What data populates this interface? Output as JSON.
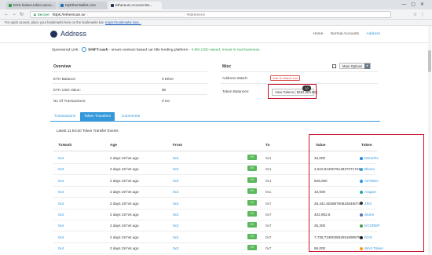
{
  "browser": {
    "tabs": [
      {
        "title": "EOS.halves.token.amou...",
        "favicon_color": "#2d9c4a"
      },
      {
        "title": "MyEtherWallet.com",
        "favicon_color": "#1f6fb5"
      },
      {
        "title": "Ethereum Account Bo...",
        "favicon_color": "#21325b"
      }
    ],
    "url_secure_label": "Secure",
    "url_prefix": "https://etherscan.io/",
    "url_suffix": "#tokentxns",
    "bookmarks_text": "For quick access, place your bookmarks here on the bookmarks bar.",
    "bookmarks_link": "Import bookmarks now..."
  },
  "site": {
    "title": "Address",
    "nav": [
      "Home",
      "Normal Accounts",
      "Address"
    ]
  },
  "sponsored": {
    "label": "Sponsored Link:",
    "name": "SHIFT.cash",
    "desc": "- smart-contract based car title lending platform -",
    "highlight": "4.9M USD raised. Invest in real business."
  },
  "overview": {
    "title": "Overview",
    "rows": [
      {
        "label": "ETH Balance:",
        "value": "0 Ether"
      },
      {
        "label": "ETH USD Value:",
        "value": "$0"
      },
      {
        "label": "No Of Transactions:",
        "value": "0 txn"
      }
    ]
  },
  "misc": {
    "title": "Misc",
    "more_options": "More Options",
    "address_watch_label": "Address Watch:",
    "watch_button": "Add To Watch List",
    "token_balances_label": "Token Balances:",
    "view_tokens": "View Tokens ( $352,859.93 )",
    "token_count": "10"
  },
  "tabs": [
    "Transactions",
    "Token Transfers",
    "Comments"
  ],
  "active_tab": "Token Transfers",
  "events_caption": "Latest 11 Erc20 Token Transfer Events",
  "table": {
    "headers": [
      "TxHash",
      "Age",
      "From",
      "",
      "To",
      "Value",
      "Token"
    ],
    "rows": [
      {
        "hash": "0x4",
        "age": "2 days 19 hrs ago",
        "from": "0x3",
        "dir": "IN",
        "to": "0x1",
        "value": "34,000",
        "token": "MonoFix",
        "token_color": "#1e88e5"
      },
      {
        "hash": "0x3",
        "age": "2 days 19 hrs ago",
        "from": "0x3",
        "dir": "IN",
        "to": "0x1",
        "value": "2,510.912507514827271741",
        "token": "Bloom",
        "token_color": "#3498db"
      },
      {
        "hash": "0x4",
        "age": "2 days 19 hrs ago",
        "from": "0x3",
        "dir": "IN",
        "to": "0x1",
        "value": "526,000",
        "token": "AirToken",
        "token_color": "#2196f3"
      },
      {
        "hash": "0x4",
        "age": "2 days 19 hrs ago",
        "from": "0x3",
        "dir": "IN",
        "to": "0x1",
        "value": "10,000",
        "token": "Aragon",
        "token_color": "#26a69a"
      },
      {
        "hash": "0x4",
        "age": "2 days 19 hrs ago",
        "from": "0x3",
        "dir": "IN",
        "to": "0x7",
        "value": "28,441.503887508228480748",
        "token": "ZRX",
        "token_color": "#333333"
      },
      {
        "hash": "0x4",
        "age": "2 days 19 hrs ago",
        "from": "0x3",
        "dir": "IN",
        "to": "0x7",
        "value": "402,902.5",
        "token": "Storm",
        "token_color": "#5c6bc0"
      },
      {
        "hash": "0x4",
        "age": "2 days 19 hrs ago",
        "from": "0x3",
        "dir": "IN",
        "to": "0x7",
        "value": "25,300",
        "token": "ECOREP",
        "token_color": "#43a047"
      },
      {
        "hash": "0x4",
        "age": "2 days 19 hrs ago",
        "from": "0x3",
        "dir": "IN",
        "to": "0x7",
        "value": "7,738.724803862551699575",
        "token": "EOS",
        "token_color": "#222222"
      },
      {
        "hash": "0x4",
        "age": "2 days 19 hrs ago",
        "from": "0x3",
        "dir": "IN",
        "to": "0x7",
        "value": "96,000",
        "token": "WAX Token",
        "token_color": "#ff9800"
      }
    ]
  },
  "colors": {
    "accent": "#3498db",
    "highlight_box": "#c8102e",
    "in_badge": "#5cb85c"
  }
}
